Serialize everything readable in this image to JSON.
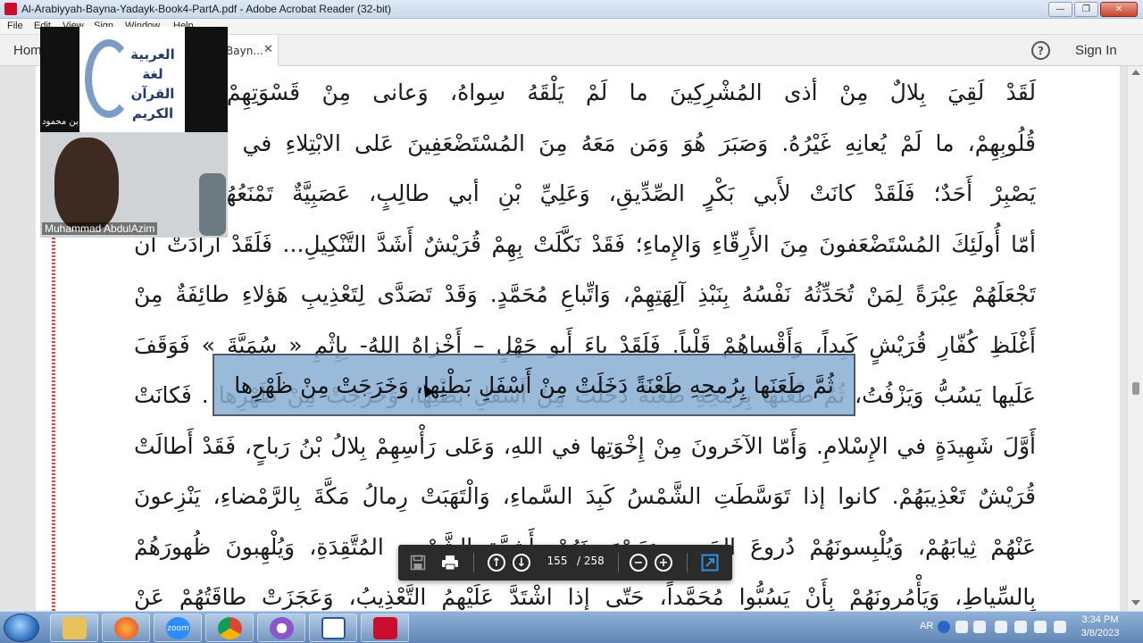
{
  "window": {
    "title": "Al-Arabiyyah-Bayna-Yadayk-Book4-PartA.pdf - Adobe Acrobat Reader (32-bit)",
    "controls": {
      "minimize": "—",
      "maximize": "❐",
      "close": "✕"
    }
  },
  "menu": [
    "File",
    "Edit",
    "View",
    "Sign",
    "Window",
    "Help"
  ],
  "tabs": {
    "home": "Hom",
    "document": "Bayn...",
    "close_glyph": "✕"
  },
  "header": {
    "help_glyph": "?",
    "sign_in": "Sign In"
  },
  "document": {
    "lines": [
      "لَقَدْ لَقِيَ بِلالٌ مِنْ أذى المُشْرِكِينَ ما لَمْ يَلْقَهُ سِواهُ، وَعانى مِنْ قَسْوَتِهِمْ، وَبَطْشِ",
      "قُلُوبِهِمْ، ما لَمْ يُعانِهِ غَيْرُهُ. وَصَبَرَ هُوَ وَمَن مَعَهُ مِنَ المُسْتَضْعَفِينَ عَلى الابْتِلاءِ في سَبِيلِ الله",
      "يَصْبِرْ أَحَدٌ؛ فَلَقَدْ كانَتْ لأَبي بَكْرٍ الصِّدِّيقِ، وَعَلِيِّ بْنِ أبي طالِبٍ، عَصَبِيَّةٌ تَمْنَعُهُما، وَقَوْمٌ",
      "أمّا أُولَئِكَ المُسْتَضْعَفونَ مِنَ الأَرِقّاءِ وَالإِماءِ؛ فَقَدْ نَكَّلَتْ بِهِمْ قُرَيْشٌ أَشَدَّ التَّنْكِيلِ... فَلَقَدْ أرادَتْ أن",
      "تَجْعَلَهُمْ عِبْرَةً لِمَنْ تُحَدِّثُهُ نَفْسُهُ بِنَبْذِ آلِهَتِهِمْ، وَاتِّباعِ مُحَمَّدٍ. وَقَدْ تَصَدَّى لِتَعْذِيبِ هَؤلاءِ طائِفَةٌ مِنْ",
      "أَغْلَظِ كُفّارِ قُرَيْشٍ كَبِداً، وَأَقْساهُمْ قَلْباً. فَلَقَدْ باءَ أَبو جَهْلٍ – أَخْزاهُ اللهُ- بِإِثْمِ « سُمَيَّةَ » فَوَقَفَ",
      "عَلَيها يَسُبُّ وَيَزْفُتُ، ثُمَّ طَعَنَها بِرُمحِهِ طَعْنَةً دَخَلَتْ مِنْ أَسْفَلِ بَطْنِها، وَخَرَجَتْ مِنْ ظَهْرِها . فَكانَتْ",
      "أَوَّلَ شَهِيدَةٍ في الإِسْلامِ. وَأَمّا الآخَرونَ مِنْ إِخْوَتِها في اللهِ، وَعَلى رَأْسِهِمْ بِلالُ بْنُ رَباحٍ، فَقَدْ أَطالَتْ",
      "قُرَيْشٌ تَعْذِيبَهُمْ. كانوا إذا تَوَسَّطَتِ الشَّمْسُ كَبِدَ السَّماءِ، وَالْتَهَبَتْ رِمالُ مَكَّةَ بِالرَّمْضاءِ، يَنْزِعونَ",
      "عَنْهُمْ ثِيابَهُمْ، وَيُلْبِسونَهُمْ دُروعَ الحَدِيدِ، وَيَصْهَرونَهُمْ بِأَشِعَّةِ الشَّمْسِ المُتَّقِدَةِ، وَيُلْهِبونَ ظُهورَهُمْ",
      "بِالسِّياطِ، وَيَأْمُرونَهُمْ بِأَنْ يَسُبُّوا مُحَمَّداً، حَتّى إِذا اشْتَدَّ عَلَيْهِمُ التَّعْذِيبُ، وَعَجَزَتْ طاقَتُهُمْ عَنْ"
    ],
    "highlighted_text": "ثُمَّ طَعَنَها بِرُمحِهِ طَعْنَةً دَخَلَتْ مِنْ أَسْفَلِ بَطْنِها، وَخَرَجَتْ مِنْ ظَهْرِها"
  },
  "page_toolbar": {
    "current_page": "155",
    "total_pages": "/ 258",
    "icons": [
      "save-icon",
      "print-icon",
      "page-up-icon",
      "page-down-icon",
      "zoom-out-icon",
      "zoom-in-icon",
      "fit-page-icon"
    ],
    "up_glyph": "↑",
    "down_glyph": "↓",
    "minus_glyph": "−",
    "plus_glyph": "+"
  },
  "video": {
    "logo_text": "العربية لغة القرآن الكريم",
    "presenter_label": "محمد بن محمود",
    "participant_name": "Muhammad AbdulAzim"
  },
  "taskbar": {
    "apps": [
      "file-explorer",
      "firefox",
      "zoom",
      "chrome",
      "browser",
      "word",
      "acrobat"
    ],
    "zoom_label": "zoom",
    "language": "AR",
    "time": "3:34 PM",
    "date": "3/8/2023"
  },
  "colors": {
    "highlight": "#87afd2",
    "acrobat_red": "#c8102e",
    "taskbar": "#5f86b5"
  }
}
